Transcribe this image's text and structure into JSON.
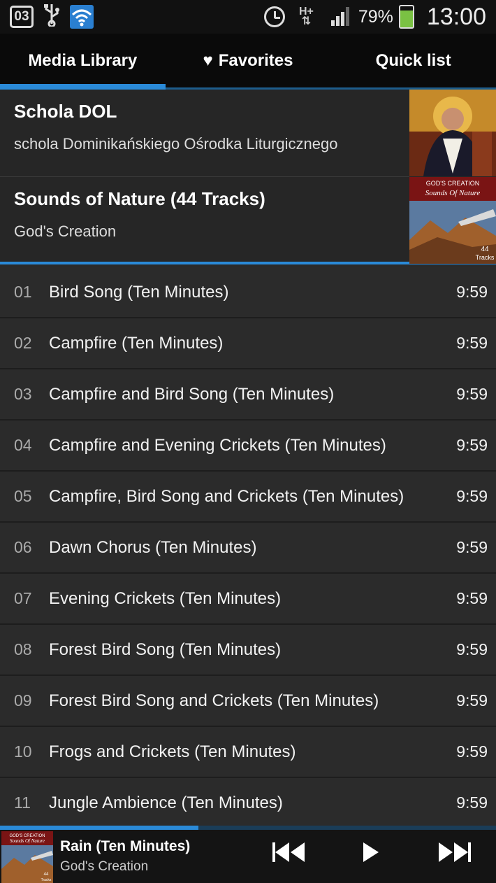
{
  "status_bar": {
    "calendar_day": "03",
    "battery_percent": "79%",
    "battery_level": 0.79,
    "network_type": "H+",
    "time": "13:00"
  },
  "tabs": [
    {
      "label": "Media Library",
      "active": true
    },
    {
      "label": "Favorites",
      "active": false,
      "icon": "heart-icon"
    },
    {
      "label": "Quick list",
      "active": false
    }
  ],
  "albums": [
    {
      "title": "Schola DOL",
      "subtitle": "schola Dominikańskiego Ośrodka Liturgicznego"
    },
    {
      "title": "Sounds of Nature (44 Tracks)",
      "subtitle": "God's Creation",
      "art_text": [
        "GOD'S CREATION",
        "Sounds Of Nature",
        "44",
        "Tracks"
      ]
    }
  ],
  "tracks": [
    {
      "num": "01",
      "title": "Bird Song (Ten Minutes)",
      "duration": "9:59"
    },
    {
      "num": "02",
      "title": "Campfire (Ten Minutes)",
      "duration": "9:59"
    },
    {
      "num": "03",
      "title": "Campfire and Bird Song (Ten Minutes)",
      "duration": "9:59"
    },
    {
      "num": "04",
      "title": "Campfire and Evening Crickets (Ten Minutes)",
      "duration": "9:59"
    },
    {
      "num": "05",
      "title": "Campfire, Bird Song and Crickets (Ten Minutes)",
      "duration": "9:59"
    },
    {
      "num": "06",
      "title": "Dawn Chorus (Ten Minutes)",
      "duration": "9:59"
    },
    {
      "num": "07",
      "title": "Evening Crickets (Ten Minutes)",
      "duration": "9:59"
    },
    {
      "num": "08",
      "title": "Forest Bird Song (Ten Minutes)",
      "duration": "9:59"
    },
    {
      "num": "09",
      "title": "Forest Bird Song and Crickets (Ten Minutes)",
      "duration": "9:59"
    },
    {
      "num": "10",
      "title": "Frogs and Crickets (Ten Minutes)",
      "duration": "9:59"
    },
    {
      "num": "11",
      "title": "Jungle Ambience (Ten Minutes)",
      "duration": "9:59"
    }
  ],
  "now_playing": {
    "title": "Rain (Ten Minutes)",
    "artist": "God's Creation",
    "progress": 0.4,
    "art_text": [
      "GOD'S CREATION",
      "Sounds Of Nature",
      "44",
      "Tracks"
    ]
  },
  "colors": {
    "accent": "#2a8ad8",
    "background": "#2b2b2b",
    "tab_bar": "#0a0a0a"
  }
}
